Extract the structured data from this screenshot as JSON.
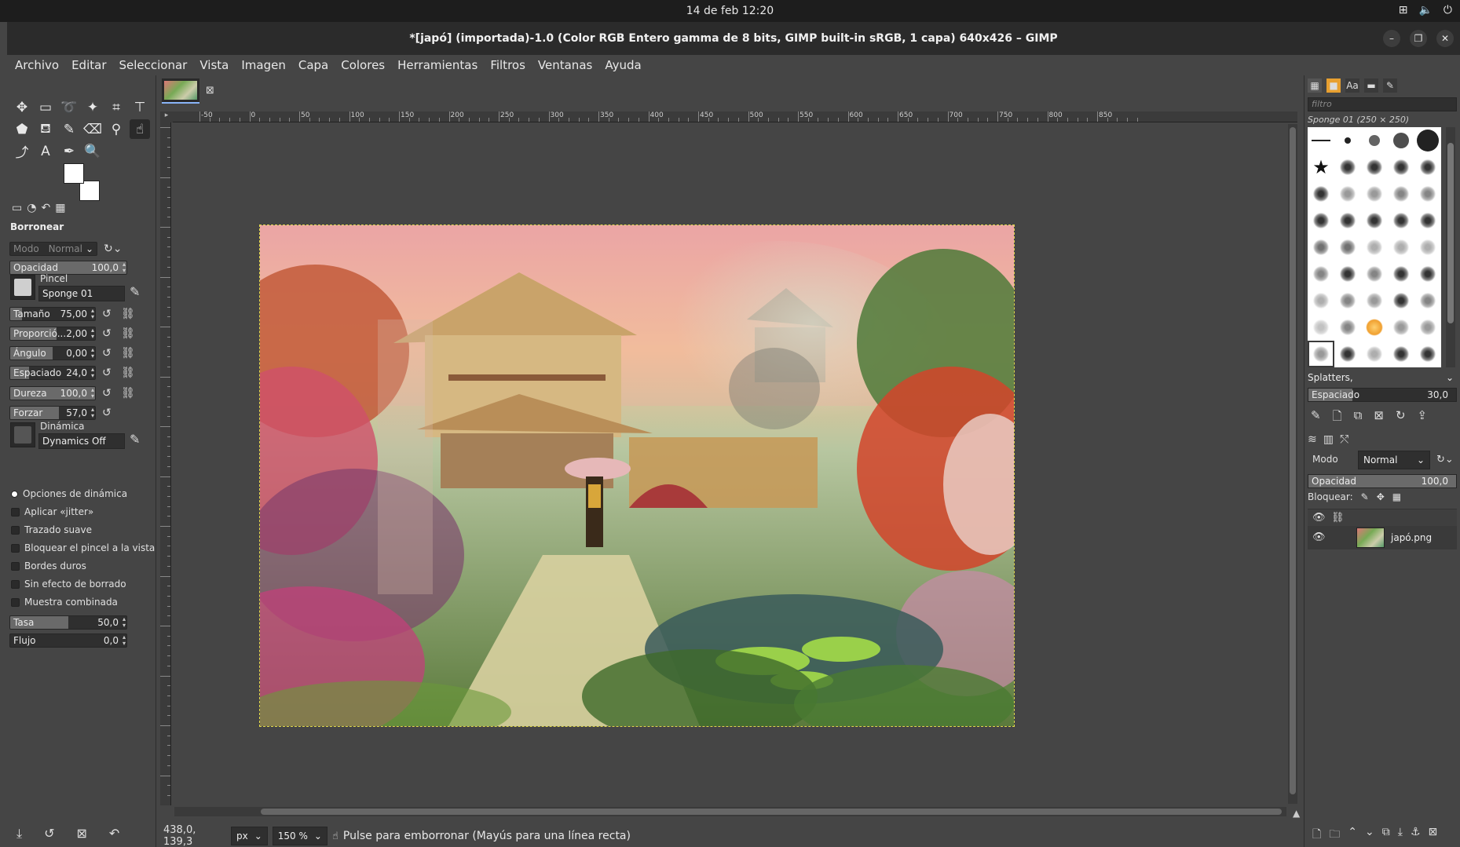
{
  "system_bar": {
    "clock": "14 de feb  12:20"
  },
  "window": {
    "title": "*[japó] (importada)-1.0 (Color RGB Entero gamma de 8 bits, GIMP built-in sRGB, 1 capa) 640x426 – GIMP"
  },
  "menu": [
    "Archivo",
    "Editar",
    "Seleccionar",
    "Vista",
    "Imagen",
    "Capa",
    "Colores",
    "Herramientas",
    "Filtros",
    "Ventanas",
    "Ayuda"
  ],
  "tool_options": {
    "title": "Borronear",
    "mode_label": "Modo",
    "mode_value": "Normal",
    "opacity": {
      "label": "Opacidad",
      "value": "100,0",
      "fraction": 1.0
    },
    "brush": {
      "label": "Pincel",
      "value": "Sponge 01"
    },
    "size": {
      "label": "Tamaño",
      "value": "75,00",
      "fraction": 0.14
    },
    "aspect": {
      "label": "Proporció...",
      "value": "2,00",
      "fraction": 0.55
    },
    "angle": {
      "label": "Ángulo",
      "value": "0,00",
      "fraction": 0.5
    },
    "spacing": {
      "label": "Espaciado",
      "value": "24,0",
      "fraction": 0.22
    },
    "hardness": {
      "label": "Dureza",
      "value": "100,0",
      "fraction": 1.0
    },
    "force": {
      "label": "Forzar",
      "value": "57,0",
      "fraction": 0.57
    },
    "dynamics": {
      "label": "Dinámica",
      "value": "Dynamics Off"
    },
    "checks": [
      {
        "label": "Opciones de dinámica",
        "on": true
      },
      {
        "label": "Aplicar «jitter»",
        "on": false
      },
      {
        "label": "Trazado suave",
        "on": false
      },
      {
        "label": "Bloquear el pincel a la vista",
        "on": false
      },
      {
        "label": "Bordes duros",
        "on": false
      },
      {
        "label": "Sin efecto de borrado",
        "on": false
      },
      {
        "label": "Muestra combinada",
        "on": false
      }
    ],
    "rate": {
      "label": "Tasa",
      "value": "50,0",
      "fraction": 0.5
    },
    "flow": {
      "label": "Flujo",
      "value": "0,0",
      "fraction": 0.0
    }
  },
  "rulers": {
    "top_labels": [
      "-50",
      "0",
      "50",
      "100",
      "150",
      "200",
      "250",
      "300",
      "350",
      "400",
      "450",
      "500",
      "550",
      "600",
      "650",
      "700",
      "750",
      "800",
      "850"
    ]
  },
  "status": {
    "coords": "438,0, 139,3",
    "unit": "px",
    "zoom": "150 %",
    "message": "Pulse para emborronar (Mayús para una línea recta)"
  },
  "brushes_panel": {
    "filter_placeholder": "filtro",
    "caption": "Sponge 01 (250 × 250)",
    "tag": "Splatters,",
    "spacing": {
      "label": "Espaciado",
      "value": "30,0",
      "fraction": 0.3
    }
  },
  "layers_panel": {
    "mode_label": "Modo",
    "mode_value": "Normal",
    "opacity_label": "Opacidad",
    "opacity_value": "100,0",
    "lock_label": "Bloquear:",
    "layer_name": "japó.png"
  }
}
